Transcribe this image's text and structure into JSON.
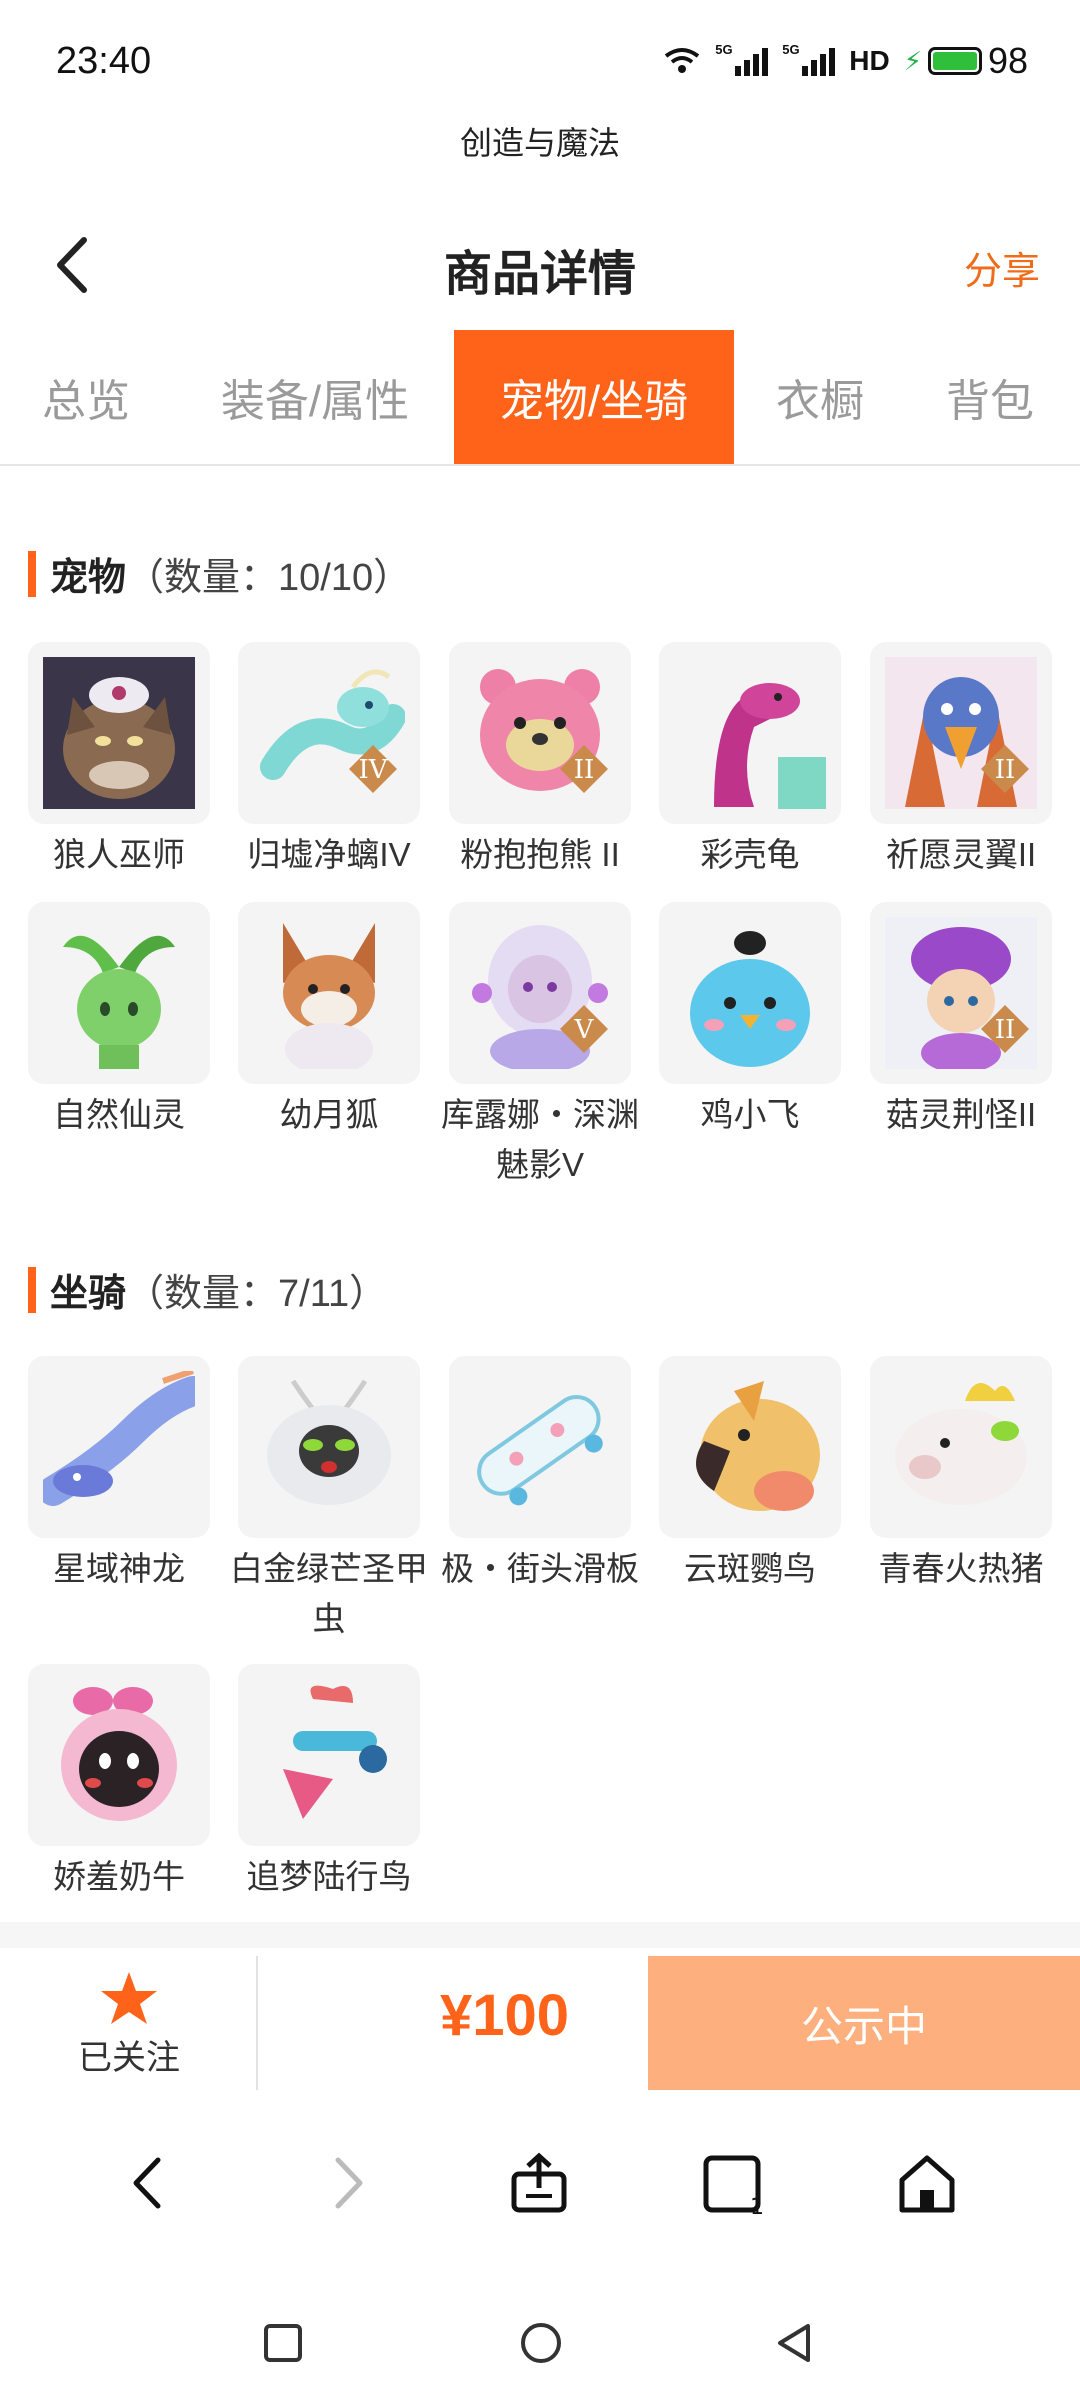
{
  "status_bar": {
    "time": "23:40",
    "signal1": "5G",
    "signal2": "5G",
    "hd": "HD",
    "battery": "98"
  },
  "app_name": "创造与魔法",
  "header": {
    "title": "商品详情",
    "share_label": "分享"
  },
  "tabs": [
    {
      "label": "总览",
      "active": false
    },
    {
      "label": "装备/属性",
      "active": false
    },
    {
      "label": "宠物/坐骑",
      "active": true
    },
    {
      "label": "衣橱",
      "active": false
    },
    {
      "label": "背包",
      "active": false
    }
  ],
  "pets": {
    "title": "宠物",
    "count": "（数量：10/10）",
    "items": [
      {
        "label": "狼人巫师",
        "icon": "werewolf-wizard-icon",
        "badge": ""
      },
      {
        "label": "归墟净螭IV",
        "icon": "water-dragon-icon",
        "badge": "IV"
      },
      {
        "label": "粉抱抱熊 II",
        "icon": "pink-bear-icon",
        "badge": "II"
      },
      {
        "label": "彩壳龟",
        "icon": "shell-turtle-icon",
        "badge": ""
      },
      {
        "label": "祈愿灵翼II",
        "icon": "wish-bird-icon",
        "badge": "II"
      },
      {
        "label": "自然仙灵",
        "icon": "nature-sprite-icon",
        "badge": ""
      },
      {
        "label": "幼月狐",
        "icon": "moon-fox-icon",
        "badge": ""
      },
      {
        "label": "库露娜・深渊魅影V",
        "icon": "abyss-girl-icon",
        "badge": "V"
      },
      {
        "label": "鸡小飞",
        "icon": "blue-chick-icon",
        "badge": ""
      },
      {
        "label": "菇灵荆怪II",
        "icon": "mushroom-elf-icon",
        "badge": "II"
      }
    ]
  },
  "mounts": {
    "title": "坐骑",
    "count": "（数量：7/11）",
    "items": [
      {
        "label": "星域神龙",
        "icon": "star-dragon-icon"
      },
      {
        "label": "白金绿芒圣甲虫",
        "icon": "platinum-beetle-icon"
      },
      {
        "label": "极・街头滑板",
        "icon": "skateboard-icon"
      },
      {
        "label": "云斑鹦鸟",
        "icon": "cloud-parrot-icon"
      },
      {
        "label": "青春火热猪",
        "icon": "fire-pig-icon"
      },
      {
        "label": "娇羞奶牛",
        "icon": "shy-cow-icon"
      },
      {
        "label": "追梦陆行鸟",
        "icon": "dream-bird-icon"
      }
    ]
  },
  "bottom": {
    "follow_label": "已关注",
    "price": "¥100",
    "status_label": "公示中"
  },
  "colors": {
    "accent": "#ff6219",
    "share": "#ef6c1a",
    "status_button": "#fdaf7d",
    "star": "#ff6219"
  }
}
